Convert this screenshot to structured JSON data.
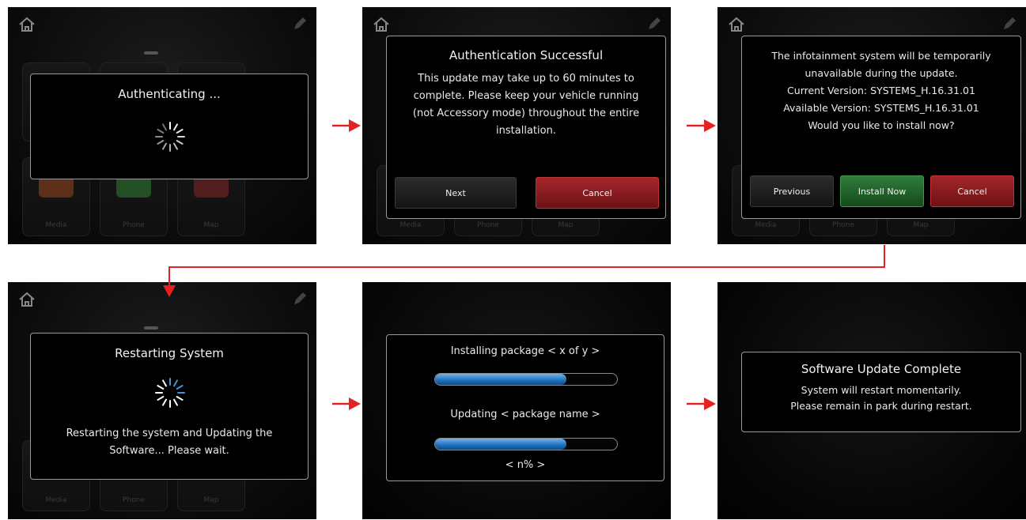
{
  "colors": {
    "arrow": "#e52222",
    "progress": "#2f86d3",
    "cancel": "#8f1c20",
    "install": "#236a2d"
  },
  "icons": {
    "home": "home-icon",
    "edit": "pen-icon"
  },
  "screen1": {
    "title": "Authenticating ...",
    "background_tiles": [
      "Media",
      "Phone",
      "Map"
    ]
  },
  "screen2": {
    "title": "Authentication Successful",
    "body": [
      "This update may take up to 60 minutes to",
      "complete. Please keep your vehicle running",
      "(not Accessory mode) throughout the entire",
      "installation."
    ],
    "buttons": {
      "next": "Next",
      "cancel": "Cancel"
    },
    "background_tiles": [
      "Media",
      "Phone",
      "Map"
    ]
  },
  "screen3": {
    "body": [
      "The infotainment system will be temporarily",
      "unavailable during the update.",
      "Current Version: SYSTEMS_H.16.31.01",
      "Available Version: SYSTEMS_H.16.31.01",
      "Would you like to install now?"
    ],
    "buttons": {
      "previous": "Previous",
      "install": "Install Now",
      "cancel": "Cancel"
    },
    "background_tiles": [
      "Media",
      "Phone",
      "Map"
    ]
  },
  "screen4": {
    "title": "Restarting System",
    "body": [
      "Restarting the system and Updating the",
      "Software... Please wait."
    ],
    "background_tiles": [
      "Media",
      "Phone",
      "Map"
    ]
  },
  "screen5": {
    "package_line": "Installing package < x of y >",
    "package_progress": 0.72,
    "updating_line": "Updating < package name >",
    "update_progress": 0.72,
    "percent": "< n% >"
  },
  "screen6": {
    "title": "Software Update Complete",
    "body": [
      "System will restart momentarily.",
      "Please remain in park during restart."
    ]
  }
}
